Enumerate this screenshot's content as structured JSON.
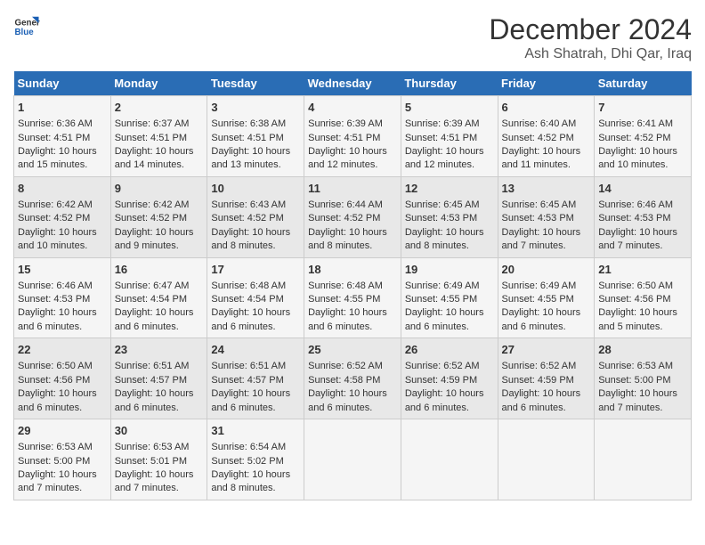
{
  "header": {
    "logo_general": "General",
    "logo_blue": "Blue",
    "month_title": "December 2024",
    "location": "Ash Shatrah, Dhi Qar, Iraq"
  },
  "calendar": {
    "days_of_week": [
      "Sunday",
      "Monday",
      "Tuesday",
      "Wednesday",
      "Thursday",
      "Friday",
      "Saturday"
    ],
    "weeks": [
      [
        {
          "day": "1",
          "sunrise": "Sunrise: 6:36 AM",
          "sunset": "Sunset: 4:51 PM",
          "daylight": "Daylight: 10 hours and 15 minutes."
        },
        {
          "day": "2",
          "sunrise": "Sunrise: 6:37 AM",
          "sunset": "Sunset: 4:51 PM",
          "daylight": "Daylight: 10 hours and 14 minutes."
        },
        {
          "day": "3",
          "sunrise": "Sunrise: 6:38 AM",
          "sunset": "Sunset: 4:51 PM",
          "daylight": "Daylight: 10 hours and 13 minutes."
        },
        {
          "day": "4",
          "sunrise": "Sunrise: 6:39 AM",
          "sunset": "Sunset: 4:51 PM",
          "daylight": "Daylight: 10 hours and 12 minutes."
        },
        {
          "day": "5",
          "sunrise": "Sunrise: 6:39 AM",
          "sunset": "Sunset: 4:51 PM",
          "daylight": "Daylight: 10 hours and 12 minutes."
        },
        {
          "day": "6",
          "sunrise": "Sunrise: 6:40 AM",
          "sunset": "Sunset: 4:52 PM",
          "daylight": "Daylight: 10 hours and 11 minutes."
        },
        {
          "day": "7",
          "sunrise": "Sunrise: 6:41 AM",
          "sunset": "Sunset: 4:52 PM",
          "daylight": "Daylight: 10 hours and 10 minutes."
        }
      ],
      [
        {
          "day": "8",
          "sunrise": "Sunrise: 6:42 AM",
          "sunset": "Sunset: 4:52 PM",
          "daylight": "Daylight: 10 hours and 10 minutes."
        },
        {
          "day": "9",
          "sunrise": "Sunrise: 6:42 AM",
          "sunset": "Sunset: 4:52 PM",
          "daylight": "Daylight: 10 hours and 9 minutes."
        },
        {
          "day": "10",
          "sunrise": "Sunrise: 6:43 AM",
          "sunset": "Sunset: 4:52 PM",
          "daylight": "Daylight: 10 hours and 8 minutes."
        },
        {
          "day": "11",
          "sunrise": "Sunrise: 6:44 AM",
          "sunset": "Sunset: 4:52 PM",
          "daylight": "Daylight: 10 hours and 8 minutes."
        },
        {
          "day": "12",
          "sunrise": "Sunrise: 6:45 AM",
          "sunset": "Sunset: 4:53 PM",
          "daylight": "Daylight: 10 hours and 8 minutes."
        },
        {
          "day": "13",
          "sunrise": "Sunrise: 6:45 AM",
          "sunset": "Sunset: 4:53 PM",
          "daylight": "Daylight: 10 hours and 7 minutes."
        },
        {
          "day": "14",
          "sunrise": "Sunrise: 6:46 AM",
          "sunset": "Sunset: 4:53 PM",
          "daylight": "Daylight: 10 hours and 7 minutes."
        }
      ],
      [
        {
          "day": "15",
          "sunrise": "Sunrise: 6:46 AM",
          "sunset": "Sunset: 4:53 PM",
          "daylight": "Daylight: 10 hours and 6 minutes."
        },
        {
          "day": "16",
          "sunrise": "Sunrise: 6:47 AM",
          "sunset": "Sunset: 4:54 PM",
          "daylight": "Daylight: 10 hours and 6 minutes."
        },
        {
          "day": "17",
          "sunrise": "Sunrise: 6:48 AM",
          "sunset": "Sunset: 4:54 PM",
          "daylight": "Daylight: 10 hours and 6 minutes."
        },
        {
          "day": "18",
          "sunrise": "Sunrise: 6:48 AM",
          "sunset": "Sunset: 4:55 PM",
          "daylight": "Daylight: 10 hours and 6 minutes."
        },
        {
          "day": "19",
          "sunrise": "Sunrise: 6:49 AM",
          "sunset": "Sunset: 4:55 PM",
          "daylight": "Daylight: 10 hours and 6 minutes."
        },
        {
          "day": "20",
          "sunrise": "Sunrise: 6:49 AM",
          "sunset": "Sunset: 4:55 PM",
          "daylight": "Daylight: 10 hours and 6 minutes."
        },
        {
          "day": "21",
          "sunrise": "Sunrise: 6:50 AM",
          "sunset": "Sunset: 4:56 PM",
          "daylight": "Daylight: 10 hours and 5 minutes."
        }
      ],
      [
        {
          "day": "22",
          "sunrise": "Sunrise: 6:50 AM",
          "sunset": "Sunset: 4:56 PM",
          "daylight": "Daylight: 10 hours and 6 minutes."
        },
        {
          "day": "23",
          "sunrise": "Sunrise: 6:51 AM",
          "sunset": "Sunset: 4:57 PM",
          "daylight": "Daylight: 10 hours and 6 minutes."
        },
        {
          "day": "24",
          "sunrise": "Sunrise: 6:51 AM",
          "sunset": "Sunset: 4:57 PM",
          "daylight": "Daylight: 10 hours and 6 minutes."
        },
        {
          "day": "25",
          "sunrise": "Sunrise: 6:52 AM",
          "sunset": "Sunset: 4:58 PM",
          "daylight": "Daylight: 10 hours and 6 minutes."
        },
        {
          "day": "26",
          "sunrise": "Sunrise: 6:52 AM",
          "sunset": "Sunset: 4:59 PM",
          "daylight": "Daylight: 10 hours and 6 minutes."
        },
        {
          "day": "27",
          "sunrise": "Sunrise: 6:52 AM",
          "sunset": "Sunset: 4:59 PM",
          "daylight": "Daylight: 10 hours and 6 minutes."
        },
        {
          "day": "28",
          "sunrise": "Sunrise: 6:53 AM",
          "sunset": "Sunset: 5:00 PM",
          "daylight": "Daylight: 10 hours and 7 minutes."
        }
      ],
      [
        {
          "day": "29",
          "sunrise": "Sunrise: 6:53 AM",
          "sunset": "Sunset: 5:00 PM",
          "daylight": "Daylight: 10 hours and 7 minutes."
        },
        {
          "day": "30",
          "sunrise": "Sunrise: 6:53 AM",
          "sunset": "Sunset: 5:01 PM",
          "daylight": "Daylight: 10 hours and 7 minutes."
        },
        {
          "day": "31",
          "sunrise": "Sunrise: 6:54 AM",
          "sunset": "Sunset: 5:02 PM",
          "daylight": "Daylight: 10 hours and 8 minutes."
        },
        null,
        null,
        null,
        null
      ]
    ]
  }
}
